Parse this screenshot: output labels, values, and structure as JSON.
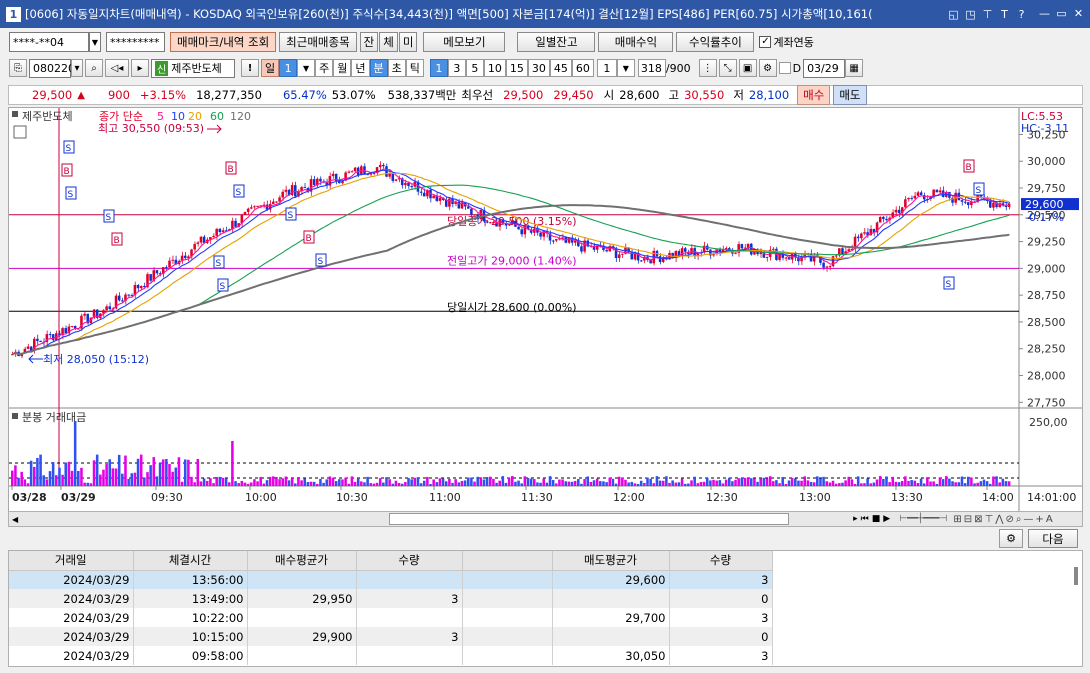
{
  "window": {
    "number": "1",
    "title": "[0606] 자동일지차트(매매내역) - KOSDAQ 외국인보유[260(천)] 주식수[34,443(천)] 액면[500] 자본금[174(억)] 결산[12월] EPS[486] PER[60.75] 시가총액[10,161(",
    "icons": [
      "◱",
      "◳",
      "⊤",
      "T",
      "?"
    ],
    "controls": [
      "—",
      "▭",
      "✕"
    ]
  },
  "toolbar1": {
    "account": "****-**04",
    "password": "*********",
    "buttons": [
      "매매마크/내역 조회",
      "최근매매종목",
      "잔",
      "체",
      "미",
      "메모보기",
      "일별잔고",
      "매매수익",
      "수익률추이"
    ],
    "checkbox_label": "계좌연동",
    "checkbox_checked": true
  },
  "toolbar2": {
    "code": "080220",
    "stock_name_badge": "신",
    "stock_name": "제주반도체",
    "periods": [
      "일",
      "1",
      "주",
      "월",
      "년",
      "분",
      "초",
      "틱"
    ],
    "minutes": [
      "1",
      "3",
      "5",
      "10",
      "15",
      "30",
      "45",
      "60"
    ],
    "count_select": "1",
    "view_count": "318",
    "view_total": "/900",
    "date": "03/29",
    "day_check_label": "D"
  },
  "quote": {
    "price": "29,500",
    "arrow": "▲",
    "change": "900",
    "pct": "+3.15%",
    "volume": "18,277,350",
    "ratio1": "65.47%",
    "ratio2": "53.07%",
    "amount": "538,337백만",
    "best_label": "최우선",
    "ask": "29,500",
    "bid": "29,450",
    "open_label": "시",
    "open": "28,600",
    "high_label": "고",
    "high": "30,550",
    "low_label": "저",
    "low": "28,100",
    "buy": "매수",
    "sell": "매도"
  },
  "chart": {
    "stock_label": "제주반도체",
    "ma_label": "종가 단순",
    "ma_periods": [
      "5",
      "10",
      "20",
      "60",
      "120"
    ],
    "high_note": "최고 30,550 (09:53)",
    "low_note": "최저 28,050 (15:12)",
    "lc": "LC:5.53",
    "hc": "HC:-3.11",
    "current_price": "29,600",
    "current_pct": "-0.17%",
    "hlines": [
      {
        "label": "당일종가 29,500 (3.15%)",
        "value": 29500
      },
      {
        "label": "전일고가 29,000 (1.40%)",
        "value": 29000
      },
      {
        "label": "당일시가 28,600 (0.00%)",
        "value": 28600
      }
    ],
    "y_ticks": [
      "30,250",
      "30,000",
      "29,750",
      "29,500",
      "29,250",
      "29,000",
      "28,750",
      "28,500",
      "28,250",
      "28,000",
      "27,750"
    ],
    "vol_label": "분봉 거래대금",
    "vol_tick": "250,00",
    "x_labels": [
      "03/28",
      "03/29",
      "09:30",
      "10:00",
      "10:30",
      "11:00",
      "11:30",
      "12:00",
      "12:30",
      "13:00",
      "13:30",
      "14:00"
    ],
    "last_time": "14:01:00",
    "markers": [
      "S",
      "B",
      "S",
      "S",
      "B",
      "S",
      "S",
      "B",
      "S",
      "S",
      "B",
      "S",
      "S",
      "B",
      "S"
    ]
  },
  "chart_data": {
    "type": "line",
    "title": "",
    "x": [
      "03/28",
      "03/29 09:00",
      "09:30",
      "10:00",
      "10:30",
      "11:00",
      "11:30",
      "12:00",
      "12:30",
      "13:00",
      "13:30",
      "14:00"
    ],
    "series": [
      {
        "name": "종가",
        "values": [
          28200,
          28600,
          29200,
          29700,
          29950,
          29550,
          29250,
          29100,
          29200,
          29050,
          29700,
          29600
        ]
      }
    ],
    "ylim": [
      27650,
      30450
    ]
  },
  "trades": {
    "columns": [
      "거래일",
      "체결시간",
      "매수평균가",
      "수량",
      "",
      "매도평균가",
      "수량"
    ],
    "rows": [
      [
        "2024/03/29",
        "13:56:00",
        "",
        "",
        "",
        "29,600",
        "3"
      ],
      [
        "2024/03/29",
        "13:49:00",
        "29,950",
        "3",
        "",
        "",
        "0"
      ],
      [
        "2024/03/29",
        "10:22:00",
        "",
        "",
        "",
        "29,700",
        "3"
      ],
      [
        "2024/03/29",
        "10:15:00",
        "29,900",
        "3",
        "",
        "",
        "0"
      ],
      [
        "2024/03/29",
        "09:58:00",
        "",
        "",
        "",
        "30,050",
        "3"
      ]
    ],
    "next": "다음"
  }
}
